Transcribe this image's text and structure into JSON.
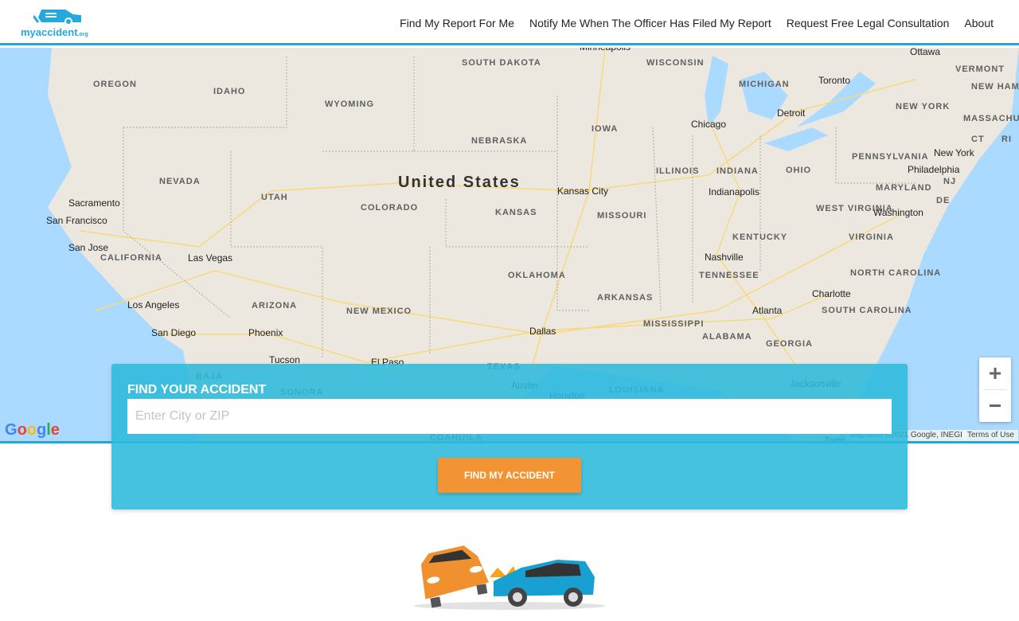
{
  "header": {
    "logo_text": "myaccident",
    "logo_suffix": ".org",
    "nav": [
      "Find My Report For Me",
      "Notify Me When The Officer Has Filed My Report",
      "Request Free Legal Consultation",
      "About"
    ]
  },
  "map": {
    "country": "United States",
    "states": [
      "SOUTH DAKOTA",
      "WISCONSIN",
      "MICHIGAN",
      "VERMONT",
      "NEW HAMPSHIRE",
      "OREGON",
      "IDAHO",
      "WYOMING",
      "NEW YORK",
      "MASSACHUSETTS",
      "IOWA",
      "NEBRASKA",
      "CT",
      "RI",
      "PENNSYLVANIA",
      "NEVADA",
      "ILLINOIS",
      "INDIANA",
      "OHIO",
      "NJ",
      "MARYLAND",
      "UTAH",
      "COLORADO",
      "KANSAS",
      "MISSOURI",
      "WEST VIRGINIA",
      "DE",
      "KENTUCKY",
      "VIRGINIA",
      "CALIFORNIA",
      "OKLAHOMA",
      "TENNESSEE",
      "NORTH CAROLINA",
      "ARKANSAS",
      "ARIZONA",
      "NEW MEXICO",
      "SOUTH CAROLINA",
      "MISSISSIPPI",
      "ALABAMA",
      "GEORGIA",
      "TEXAS",
      "LOUISIANA",
      "BAJA",
      "SONORA",
      "COAHUILA"
    ],
    "cities": [
      "Minneapolis",
      "Ottawa",
      "Toronto",
      "Detroit",
      "Chicago",
      "New York",
      "Philadelphia",
      "Kansas City",
      "Indianapolis",
      "Washington",
      "Sacramento",
      "San Francisco",
      "San Jose",
      "Las Vegas",
      "Nashville",
      "Charlotte",
      "Los Angeles",
      "San Diego",
      "Phoenix",
      "Atlanta",
      "Dallas",
      "Tucson",
      "El Paso",
      "Austin",
      "Houston",
      "Jacksonville",
      "Tampa"
    ],
    "zoom_in": "+",
    "zoom_out": "−",
    "google": "Google",
    "attribution": "Map data ©2021 Google, INEGI",
    "terms": "Terms of Use"
  },
  "search": {
    "title": "FIND YOUR ACCIDENT",
    "placeholder": "Enter City or ZIP",
    "button": "FIND MY ACCIDENT"
  },
  "colors": {
    "accent": "#1fa9d6",
    "button": "#f29433",
    "water": "#aadaff",
    "land": "#ece8df"
  }
}
